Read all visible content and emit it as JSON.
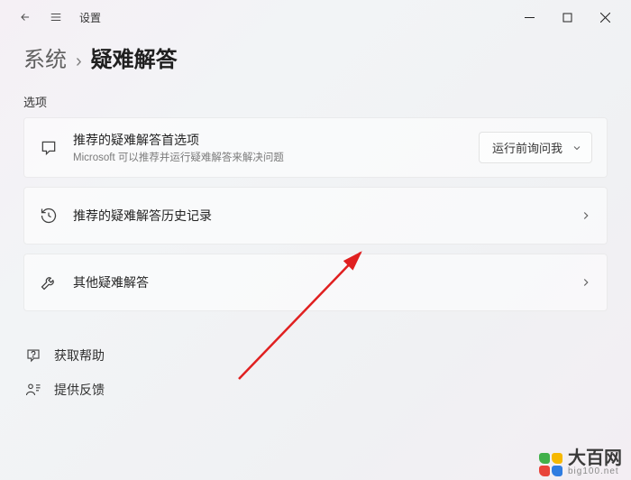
{
  "titlebar": {
    "app": "设置"
  },
  "breadcrumb": {
    "root": "系统",
    "sep": "›",
    "current": "疑难解答"
  },
  "section": "选项",
  "cards": {
    "recommended": {
      "title": "推荐的疑难解答首选项",
      "subtitle": "Microsoft 可以推荐并运行疑难解答来解决问题",
      "dropdown": "运行前询问我"
    },
    "history": {
      "title": "推荐的疑难解答历史记录"
    },
    "other": {
      "title": "其他疑难解答"
    }
  },
  "links": {
    "help": "获取帮助",
    "feedback": "提供反馈"
  },
  "watermark": {
    "brand": "大百网",
    "url": "big100.net"
  },
  "colors": {
    "logo1": "#41b04a",
    "logo2": "#f6b800",
    "logo3": "#e8443b",
    "logo4": "#2f7de1"
  }
}
